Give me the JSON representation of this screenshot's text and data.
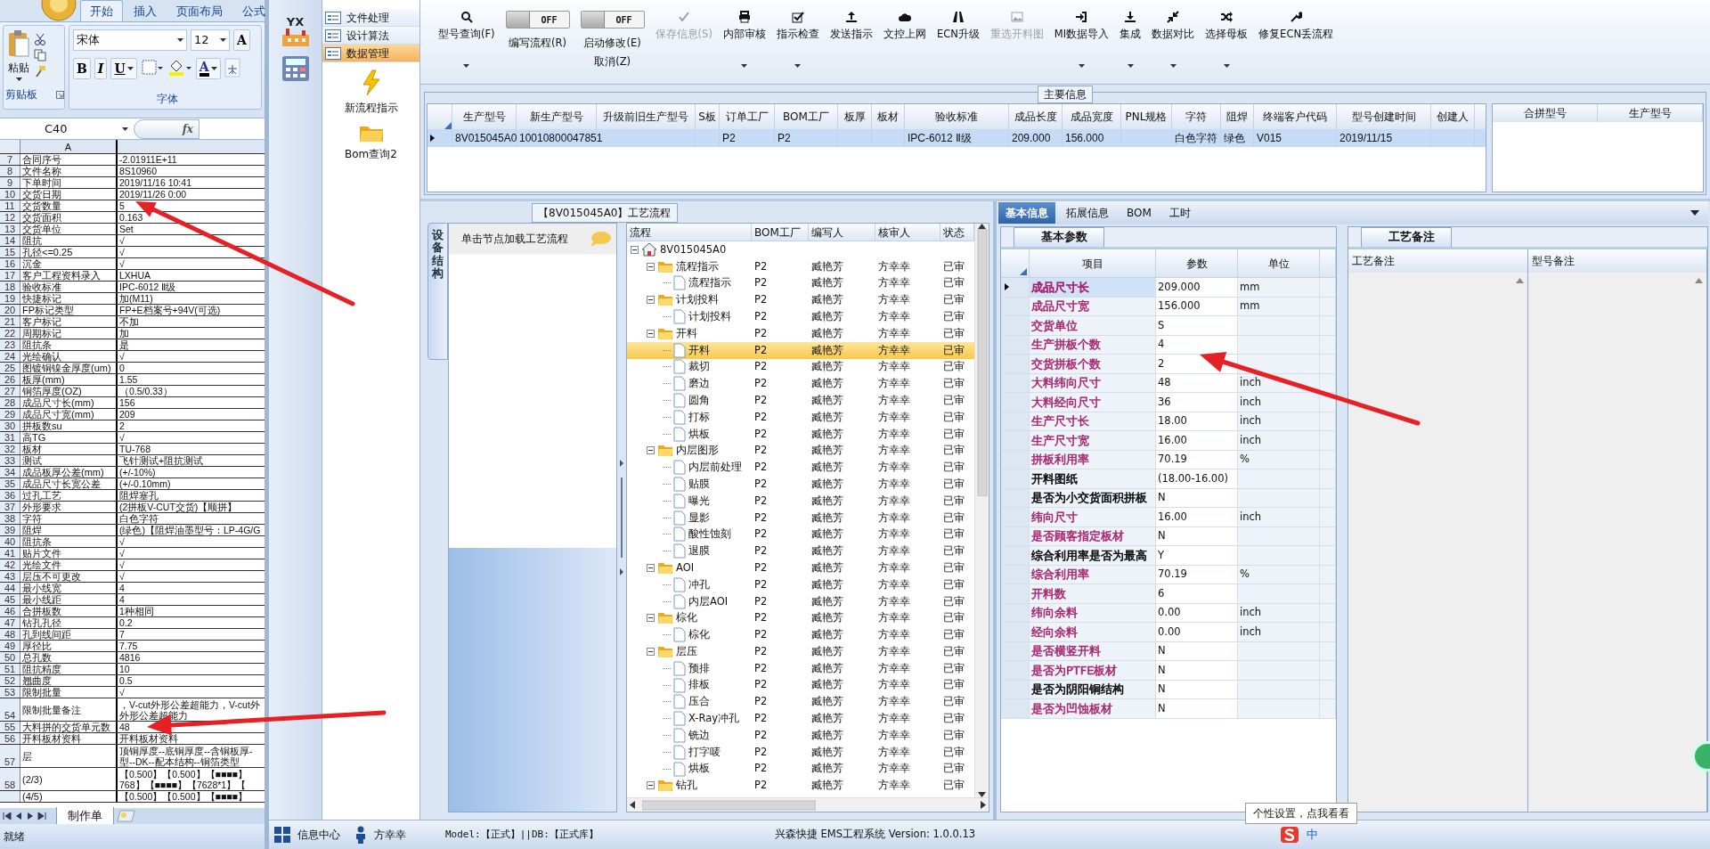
{
  "excel": {
    "tabs": [
      {
        "label": "开始",
        "selected": true
      },
      {
        "label": "插入",
        "selected": false
      },
      {
        "label": "页面布局",
        "selected": false
      },
      {
        "label": "公式",
        "selected": false
      }
    ],
    "paste": "粘贴",
    "clipboard_group": "剪贴板",
    "font_name": "宋体",
    "font_size": "12",
    "grow_font": "A",
    "bold": "B",
    "italic": "I",
    "underline": "U",
    "font_color": "A",
    "font_group": "字体",
    "name_box": "C40",
    "fx": "fx",
    "column_header": "A",
    "rows": [
      {
        "n": "7",
        "a": "合同序号",
        "b": "-2.01911E+11"
      },
      {
        "n": "8",
        "a": "文件名称",
        "b": "8S10960"
      },
      {
        "n": "9",
        "a": "下单时间",
        "b": "2019/11/16 10:41"
      },
      {
        "n": "10",
        "a": "交货日期",
        "b": "2019/11/26 0:00"
      },
      {
        "n": "11",
        "a": "交货数量",
        "b": "5"
      },
      {
        "n": "12",
        "a": "交货面积",
        "b": "0.163"
      },
      {
        "n": "13",
        "a": "交货单位",
        "b": "Set"
      },
      {
        "n": "14",
        "a": "阻抗",
        "b": "√"
      },
      {
        "n": "15",
        "a": "孔径<=0.25",
        "b": "√"
      },
      {
        "n": "16",
        "a": "沉金",
        "b": "√"
      },
      {
        "n": "17",
        "a": "客户工程资料录入",
        "b": "LXHUA"
      },
      {
        "n": "18",
        "a": "验收标准",
        "b": "IPC-6012 Ⅱ级"
      },
      {
        "n": "19",
        "a": "快捷标记",
        "b": "加(M11)"
      },
      {
        "n": "20",
        "a": "FP标记类型",
        "b": "FP+E档案号+94V(可选)"
      },
      {
        "n": "21",
        "a": "客户标记",
        "b": "不加"
      },
      {
        "n": "22",
        "a": "周期标记",
        "b": "加"
      },
      {
        "n": "23",
        "a": "阻抗条",
        "b": "是"
      },
      {
        "n": "24",
        "a": "光绘确认",
        "b": "√"
      },
      {
        "n": "25",
        "a": "图镀铜镍金厚度(um)",
        "b": "0"
      },
      {
        "n": "26",
        "a": "板厚(mm)",
        "b": "1.55"
      },
      {
        "n": "27",
        "a": "铜箔厚度(OZ)",
        "b": "（0.5/0.33）"
      },
      {
        "n": "28",
        "a": "成品尺寸长(mm)",
        "b": "156"
      },
      {
        "n": "29",
        "a": "成品尺寸宽(mm)",
        "b": "209"
      },
      {
        "n": "30",
        "a": "拼板数su",
        "b": "2"
      },
      {
        "n": "31",
        "a": "高TG",
        "b": "√"
      },
      {
        "n": "32",
        "a": "板材",
        "b": "TU-768"
      },
      {
        "n": "33",
        "a": "测试",
        "b": "飞针测试+阻抗测试"
      },
      {
        "n": "34",
        "a": "成品板厚公差(mm)",
        "b": "(+/-10%)"
      },
      {
        "n": "35",
        "a": "成品尺寸长宽公差",
        "b": "(+/-0.10mm)"
      },
      {
        "n": "36",
        "a": "过孔工艺",
        "b": "阻焊塞孔"
      },
      {
        "n": "37",
        "a": "外形要求",
        "b": "(2拼板V-CUT交货)【顺拼】"
      },
      {
        "n": "38",
        "a": "字符",
        "b": "白色字符"
      },
      {
        "n": "39",
        "a": "阻焊",
        "b": "(绿色)【阻焊油墨型号：LP-4G/G"
      },
      {
        "n": "40",
        "a": "阻抗条",
        "b": "√"
      },
      {
        "n": "41",
        "a": "贴片文件",
        "b": "√"
      },
      {
        "n": "42",
        "a": "光绘文件",
        "b": "√"
      },
      {
        "n": "43",
        "a": "层压不可更改",
        "b": "√"
      },
      {
        "n": "44",
        "a": "最小线宽",
        "b": "4"
      },
      {
        "n": "45",
        "a": "最小线距",
        "b": "4"
      },
      {
        "n": "46",
        "a": "合拼板数",
        "b": "1种相同"
      },
      {
        "n": "47",
        "a": "钻孔孔径",
        "b": "0.2"
      },
      {
        "n": "48",
        "a": "孔到线间距",
        "b": "7"
      },
      {
        "n": "49",
        "a": "厚径比",
        "b": "7.75"
      },
      {
        "n": "50",
        "a": "总孔数",
        "b": "4816"
      },
      {
        "n": "51",
        "a": "阻抗精度",
        "b": "10"
      },
      {
        "n": "52",
        "a": "翘曲度",
        "b": "0.5"
      },
      {
        "n": "53",
        "a": "限制批量",
        "b": "√"
      },
      {
        "n": "54",
        "a": "限制批量备注",
        "b": [
          "，V-cut外形公差超能力，V-cut外",
          "外形公差超能力"
        ]
      },
      {
        "n": "55",
        "a": "大料拼的交货单元数",
        "b": "48"
      },
      {
        "n": "56",
        "a": "开料板材资料",
        "b": "开料板材资料"
      },
      {
        "n": "57",
        "a": "层",
        "b": [
          "顶铜厚度--底铜厚度--含铜板厚-",
          "型--DK--配本结构--铜箔类型"
        ]
      },
      {
        "n": "58",
        "a": "(2/3)",
        "b": [
          "【0.500】【0.500】【■■■■】",
          "768】【■■■■】【7628*1】【"
        ]
      },
      {
        "a": "(4/5)",
        "b": "【0.500】【0.500】【■■■■】"
      }
    ],
    "sheet_tab": "制作单",
    "status": "就绪"
  },
  "nav": {
    "logo_text": "YX",
    "menu": [
      {
        "label": "文件处理",
        "selected": false
      },
      {
        "label": "设计算法",
        "selected": false
      },
      {
        "label": "数据管理",
        "selected": true
      }
    ],
    "shortcuts": [
      {
        "label": "新流程指示",
        "kind": "bolt"
      },
      {
        "label": "Bom查询2",
        "kind": "folder"
      }
    ]
  },
  "toolbar": [
    {
      "kind": "button",
      "label": "型号查询(F)",
      "disabled": false,
      "dropdown": true
    },
    {
      "kind": "toggle",
      "label": "编写流程(R)",
      "on": false,
      "switch_text": "OFF"
    },
    {
      "kind": "toggle",
      "label": "启动修改(E)",
      "sublabel": "取消(Z)",
      "on": false,
      "switch_text": "OFF"
    },
    {
      "kind": "button",
      "label": "保存信息(S)",
      "disabled": true,
      "dropdown": false
    },
    {
      "kind": "button",
      "label": "内部审核",
      "disabled": false,
      "dropdown": true
    },
    {
      "kind": "button",
      "label": "指示检查",
      "disabled": false,
      "dropdown": true
    },
    {
      "kind": "button",
      "label": "发送指示",
      "disabled": false,
      "dropdown": false
    },
    {
      "kind": "button",
      "label": "文控上网",
      "disabled": false,
      "dropdown": false
    },
    {
      "kind": "button",
      "label": "ECN升级",
      "disabled": false,
      "dropdown": false
    },
    {
      "kind": "button",
      "label": "重选开料图",
      "disabled": true,
      "dropdown": false
    },
    {
      "kind": "button",
      "label": "MI数据导入",
      "disabled": false,
      "dropdown": true
    },
    {
      "kind": "button",
      "label": "集成",
      "disabled": false,
      "dropdown": true
    },
    {
      "kind": "button",
      "label": "数据对比",
      "disabled": false,
      "dropdown": true
    },
    {
      "kind": "button",
      "label": "选择母板",
      "disabled": false,
      "dropdown": true
    },
    {
      "kind": "button",
      "label": "修复ECN丢流程",
      "disabled": false,
      "dropdown": false
    }
  ],
  "main_info": {
    "title": "主要信息",
    "columns": [
      "生产型号",
      "新生产型号",
      "升级前旧生产型号",
      "S板",
      "订单工厂",
      "BOM工厂",
      "板厚",
      "板材",
      "验收标准",
      "成品长度",
      "成品宽度",
      "PNL规格",
      "字符",
      "阻焊",
      "终端客户代码",
      "型号创建时间",
      "创建人"
    ],
    "rows": [
      {
        "selected": true,
        "cells": [
          "8V015045A0",
          "10010800047851",
          null,
          null,
          "P2",
          "P2",
          null,
          null,
          "IPC-6012 Ⅱ级",
          "209.000",
          "156.000",
          null,
          "白色字符",
          "绿色",
          "V015",
          "2019/11/15",
          null
        ]
      }
    ],
    "side_columns": [
      "合拼型号",
      "生产型号"
    ]
  },
  "process": {
    "title": "【8V015045A0】工艺流程",
    "side_tab": "设备结构",
    "node_header": "单击节点加载工艺流程",
    "columns": [
      "流程",
      "BOM工厂",
      "编写人",
      "核审人",
      "状态"
    ],
    "tree": {
      "label": "8V015045A0",
      "kind": "root",
      "expanded": true,
      "selected": false,
      "children": [
        {
          "label": "流程指示",
          "kind": "folder",
          "expanded": true,
          "selected": false,
          "cells": [
            "P2",
            "臧艳芳",
            "方幸幸",
            "已审"
          ],
          "children": [
            {
              "label": "流程指示",
              "kind": "item",
              "selected": false,
              "cells": [
                "P2",
                "臧艳芳",
                "方幸幸",
                "已审"
              ]
            }
          ]
        },
        {
          "label": "计划投料",
          "kind": "folder",
          "expanded": true,
          "selected": false,
          "cells": [
            "P2",
            "臧艳芳",
            "方幸幸",
            "已审"
          ],
          "children": [
            {
              "label": "计划投料",
              "kind": "item",
              "selected": false,
              "cells": [
                "P2",
                "臧艳芳",
                "方幸幸",
                "已审"
              ]
            }
          ]
        },
        {
          "label": "开料",
          "kind": "folder",
          "expanded": true,
          "selected": false,
          "cells": [
            "P2",
            "臧艳芳",
            "方幸幸",
            "已审"
          ],
          "children": [
            {
              "label": "开料",
              "kind": "item",
              "selected": true,
              "cells": [
                "P2",
                "臧艳芳",
                "方幸幸",
                "已审"
              ]
            },
            {
              "label": "裁切",
              "kind": "item",
              "selected": false,
              "cells": [
                "P2",
                "臧艳芳",
                "方幸幸",
                "已审"
              ]
            },
            {
              "label": "磨边",
              "kind": "item",
              "selected": false,
              "cells": [
                "P2",
                "臧艳芳",
                "方幸幸",
                "已审"
              ]
            },
            {
              "label": "圆角",
              "kind": "item",
              "selected": false,
              "cells": [
                "P2",
                "臧艳芳",
                "方幸幸",
                "已审"
              ]
            },
            {
              "label": "打标",
              "kind": "item",
              "selected": false,
              "cells": [
                "P2",
                "臧艳芳",
                "方幸幸",
                "已审"
              ]
            },
            {
              "label": "烘板",
              "kind": "item",
              "selected": false,
              "cells": [
                "P2",
                "臧艳芳",
                "方幸幸",
                "已审"
              ]
            }
          ]
        },
        {
          "label": "内层图形",
          "kind": "folder",
          "expanded": true,
          "selected": false,
          "cells": [
            "P2",
            "臧艳芳",
            "方幸幸",
            "已审"
          ],
          "children": [
            {
              "label": "内层前处理",
              "kind": "item",
              "selected": false,
              "cells": [
                "P2",
                "臧艳芳",
                "方幸幸",
                "已审"
              ]
            },
            {
              "label": "贴膜",
              "kind": "item",
              "selected": false,
              "cells": [
                "P2",
                "臧艳芳",
                "方幸幸",
                "已审"
              ]
            },
            {
              "label": "曝光",
              "kind": "item",
              "selected": false,
              "cells": [
                "P2",
                "臧艳芳",
                "方幸幸",
                "已审"
              ]
            },
            {
              "label": "显影",
              "kind": "item",
              "selected": false,
              "cells": [
                "P2",
                "臧艳芳",
                "方幸幸",
                "已审"
              ]
            },
            {
              "label": "酸性蚀刻",
              "kind": "item",
              "selected": false,
              "cells": [
                "P2",
                "臧艳芳",
                "方幸幸",
                "已审"
              ]
            },
            {
              "label": "退膜",
              "kind": "item",
              "selected": false,
              "cells": [
                "P2",
                "臧艳芳",
                "方幸幸",
                "已审"
              ]
            }
          ]
        },
        {
          "label": "AOI",
          "kind": "folder",
          "expanded": true,
          "selected": false,
          "cells": [
            "P2",
            "臧艳芳",
            "方幸幸",
            "已审"
          ],
          "children": [
            {
              "label": "冲孔",
              "kind": "item",
              "selected": false,
              "cells": [
                "P2",
                "臧艳芳",
                "方幸幸",
                "已审"
              ]
            },
            {
              "label": "内层AOI",
              "kind": "item",
              "selected": false,
              "cells": [
                "P2",
                "臧艳芳",
                "方幸幸",
                "已审"
              ]
            }
          ]
        },
        {
          "label": "棕化",
          "kind": "folder",
          "expanded": true,
          "selected": false,
          "cells": [
            "P2",
            "臧艳芳",
            "方幸幸",
            "已审"
          ],
          "children": [
            {
              "label": "棕化",
              "kind": "item",
              "selected": false,
              "cells": [
                "P2",
                "臧艳芳",
                "方幸幸",
                "已审"
              ]
            }
          ]
        },
        {
          "label": "层压",
          "kind": "folder",
          "expanded": true,
          "selected": false,
          "cells": [
            "P2",
            "臧艳芳",
            "方幸幸",
            "已审"
          ],
          "children": [
            {
              "label": "预排",
              "kind": "item",
              "selected": false,
              "cells": [
                "P2",
                "臧艳芳",
                "方幸幸",
                "已审"
              ]
            },
            {
              "label": "排板",
              "kind": "item",
              "selected": false,
              "cells": [
                "P2",
                "臧艳芳",
                "方幸幸",
                "已审"
              ]
            },
            {
              "label": "压合",
              "kind": "item",
              "selected": false,
              "cells": [
                "P2",
                "臧艳芳",
                "方幸幸",
                "已审"
              ]
            },
            {
              "label": "X-Ray冲孔",
              "kind": "item",
              "selected": false,
              "cells": [
                "P2",
                "臧艳芳",
                "方幸幸",
                "已审"
              ]
            },
            {
              "label": "铣边",
              "kind": "item",
              "selected": false,
              "cells": [
                "P2",
                "臧艳芳",
                "方幸幸",
                "已审"
              ]
            },
            {
              "label": "打字唛",
              "kind": "item",
              "selected": false,
              "cells": [
                "P2",
                "臧艳芳",
                "方幸幸",
                "已审"
              ]
            },
            {
              "label": "烘板",
              "kind": "item",
              "selected": false,
              "cells": [
                "P2",
                "臧艳芳",
                "方幸幸",
                "已审"
              ]
            }
          ]
        },
        {
          "label": "钻孔",
          "kind": "folder",
          "expanded": true,
          "selected": false,
          "cells": [
            "P2",
            "臧艳芳",
            "方幸幸",
            "已审"
          ]
        }
      ]
    }
  },
  "details": {
    "tabs": [
      {
        "label": "基本信息",
        "selected": true
      },
      {
        "label": "拓展信息",
        "selected": false
      },
      {
        "label": "BOM",
        "selected": false
      },
      {
        "label": "工时",
        "selected": false
      }
    ],
    "params_tab": "基本参数",
    "params_columns": [
      "项目",
      "参数",
      "单位"
    ],
    "params": [
      {
        "label": "成品尺寸长",
        "value": "209.000",
        "unit": "mm",
        "color": "#a8246e",
        "selected": true
      },
      {
        "label": "成品尺寸宽",
        "value": "156.000",
        "unit": "mm",
        "color": "#a8246e",
        "selected": false
      },
      {
        "label": "交货单位",
        "value": "S",
        "color": "#a8246e",
        "selected": false
      },
      {
        "label": "生产拼板个数",
        "value": "4",
        "color": "#a8246e",
        "selected": false
      },
      {
        "label": "交货拼板个数",
        "value": "2",
        "color": "#a8246e",
        "selected": false
      },
      {
        "label": "大料纬向尺寸",
        "value": "48",
        "unit": "inch",
        "color": "#a8246e",
        "selected": false
      },
      {
        "label": "大料经向尺寸",
        "value": "36",
        "unit": "inch",
        "color": "#a8246e",
        "selected": false
      },
      {
        "label": "生产尺寸长",
        "value": "18.00",
        "unit": "inch",
        "color": "#a8246e",
        "selected": false
      },
      {
        "label": "生产尺寸宽",
        "value": "16.00",
        "unit": "inch",
        "color": "#a8246e",
        "selected": false
      },
      {
        "label": "拼板利用率",
        "value": "70.19",
        "unit": "%",
        "color": "#a8246e",
        "selected": false
      },
      {
        "label": "开料图纸",
        "value": "(18.00-16.00)",
        "color": "#000000",
        "selected": false
      },
      {
        "label": "是否为小交货面积拼板",
        "value": "N",
        "color": "#000000",
        "selected": false
      },
      {
        "label": "纬向尺寸",
        "value": "16.00",
        "unit": "inch",
        "color": "#a8246e",
        "selected": false
      },
      {
        "label": "是否顾客指定板材",
        "value": "N",
        "color": "#a8246e",
        "selected": false
      },
      {
        "label": "综合利用率是否为最高",
        "value": "Y",
        "color": "#000000",
        "selected": false
      },
      {
        "label": "综合利用率",
        "value": "70.19",
        "unit": "%",
        "color": "#a8246e",
        "selected": false
      },
      {
        "label": "开料数",
        "value": "6",
        "color": "#a8246e",
        "selected": false
      },
      {
        "label": "纬向余料",
        "value": "0.00",
        "unit": "inch",
        "color": "#a8246e",
        "selected": false
      },
      {
        "label": "经向余料",
        "value": "0.00",
        "unit": "inch",
        "color": "#a8246e",
        "selected": false
      },
      {
        "label": "是否横竖开料",
        "value": "N",
        "color": "#a8246e",
        "selected": false
      },
      {
        "label": "是否为PTFE板材",
        "value": "N",
        "color": "#a8246e",
        "selected": false
      },
      {
        "label": "是否为阴阳铜结构",
        "value": "N",
        "color": "#000000",
        "selected": false
      },
      {
        "label": "是否为凹蚀板材",
        "value": "N",
        "color": "#a8246e",
        "selected": false
      }
    ],
    "notes_tab": "工艺备注",
    "notes_columns": [
      "工艺备注",
      "型号备注"
    ]
  },
  "status_bar": {
    "items": [
      {
        "kind": "menu",
        "label": "信息中心"
      },
      {
        "kind": "user",
        "label": "方幸幸"
      }
    ],
    "connection": "Model:【正式】||DB:【正式库】",
    "product": "兴森快捷 EMS工程系统 Version: 1.0.0.13",
    "tooltip": "个性设置，点我看看",
    "ime": "中"
  }
}
